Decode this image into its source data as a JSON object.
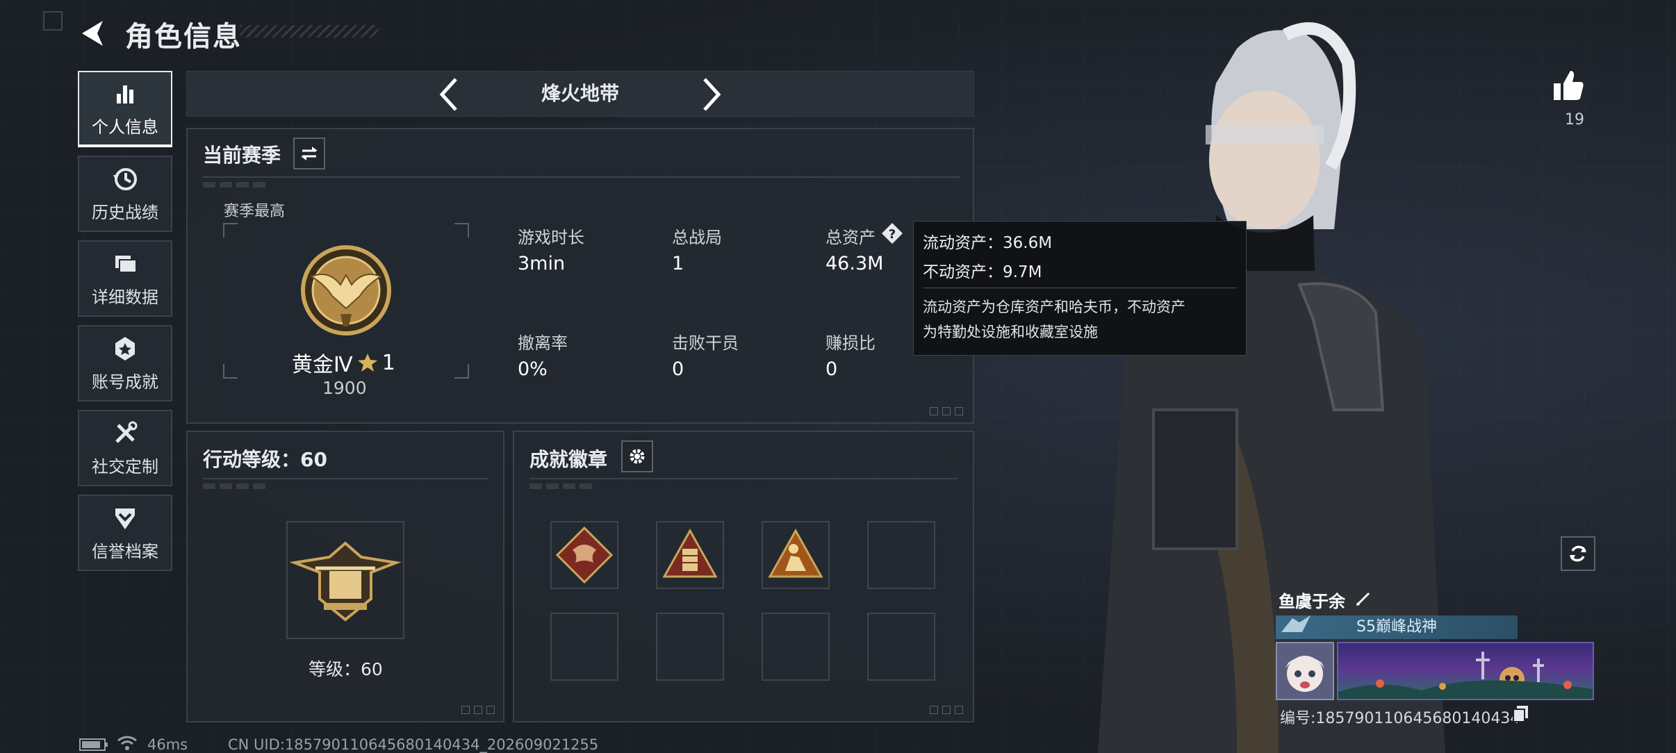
{
  "header": {
    "title": "角色信息"
  },
  "sidebar": {
    "items": [
      {
        "label": "个人信息",
        "icon": "bar-chart-icon",
        "active": true
      },
      {
        "label": "历史战绩",
        "icon": "history-clock-icon",
        "active": false
      },
      {
        "label": "详细数据",
        "icon": "folder-icon",
        "active": false
      },
      {
        "label": "账号成就",
        "icon": "achievement-icon",
        "active": false
      },
      {
        "label": "社交定制",
        "icon": "tools-icon",
        "active": false
      },
      {
        "label": "信誉档案",
        "icon": "shield-chevron-icon",
        "active": false
      }
    ]
  },
  "mode": {
    "title": "烽火地带"
  },
  "season": {
    "title": "当前赛季",
    "best_label": "赛季最高",
    "rank_name": "黄金Ⅳ",
    "rank_stars": "1",
    "rank_score": "1900",
    "stats": [
      {
        "label": "游戏时长",
        "value": "3min"
      },
      {
        "label": "总战局",
        "value": "1"
      },
      {
        "label": "总资产",
        "value": "46.3M"
      },
      {
        "label": "撤离率",
        "value": "0%"
      },
      {
        "label": "击败干员",
        "value": "0"
      },
      {
        "label": "赚损比",
        "value": "0"
      }
    ]
  },
  "tooltip": {
    "liquid": "流动资产：36.6M",
    "fixed": "不动资产：9.7M",
    "desc1": "流动资产为仓库资产和哈夫币，不动资产",
    "desc2": "为特勤处设施和收藏室设施"
  },
  "action_level": {
    "title": "行动等级：60",
    "level_text": "等级：60"
  },
  "badges": {
    "title": "成就徽章",
    "slots": [
      "dragon-badge",
      "tower-badge",
      "figure-badge",
      "",
      "",
      "",
      "",
      ""
    ]
  },
  "likes": {
    "count": "19"
  },
  "player": {
    "name": "鱼虞于余",
    "title": "S5巅峰战神",
    "id_text": "编号:1857901106456801404​34"
  },
  "status": {
    "ping": "46ms",
    "uid": "CN UID:1857901106456801404​34_202609021255"
  }
}
